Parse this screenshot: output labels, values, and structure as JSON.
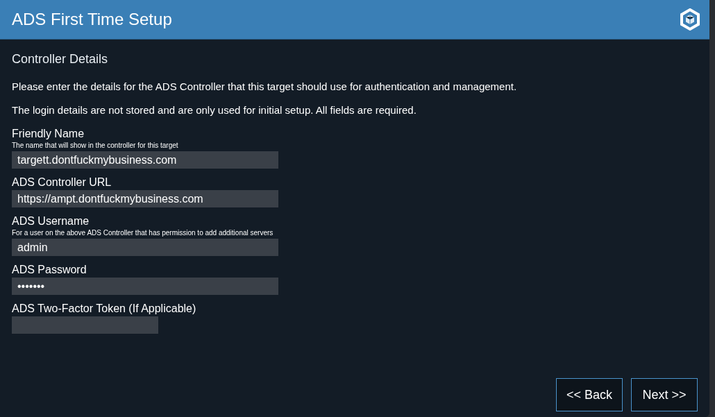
{
  "window": {
    "title": "ADS First Time Setup"
  },
  "section_title": "Controller Details",
  "paragraphs": [
    "Please enter the details for the ADS Controller that this target should use for authentication and management.",
    "The login details are not stored and are only used for initial setup. All fields are required."
  ],
  "fields": [
    {
      "label": "Friendly Name",
      "help": "The name that will show in the controller for this target",
      "value": "targett.dontfuckmybusiness.com",
      "kind": "wide"
    },
    {
      "label": "ADS Controller URL",
      "value": "https://ampt.dontfuckmybusiness.com",
      "kind": "wide"
    },
    {
      "label": "ADS Username",
      "help": "For a user on the above ADS Controller that has permission to add additional servers",
      "value": "admin",
      "kind": "wide"
    },
    {
      "label": "ADS Password",
      "value": "•••••••",
      "kind": "wide"
    },
    {
      "label": "ADS Two-Factor Token (If Applicable)",
      "kind": "narrow"
    }
  ],
  "buttons": [
    {
      "label": "<< Back"
    },
    {
      "label": "Next >>"
    }
  ]
}
